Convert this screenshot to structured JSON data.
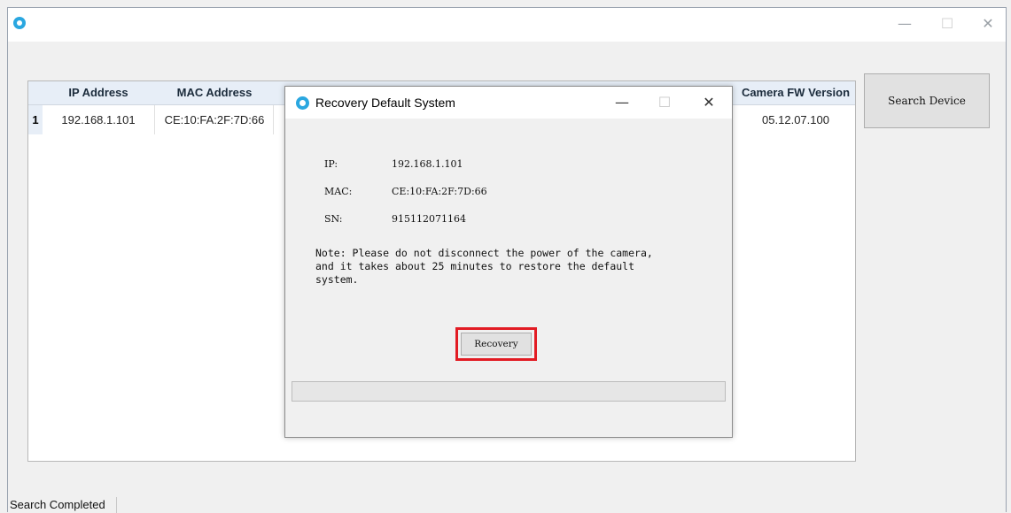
{
  "main_window": {
    "title_icon": "camera-app-icon",
    "controls": {
      "minimize": "—",
      "maximize": "☐",
      "close": "✕"
    }
  },
  "device_table": {
    "columns": [
      "IP Address",
      "MAC Address",
      "",
      "",
      "",
      "",
      "Camera FW Version"
    ],
    "rows": [
      {
        "index": "1",
        "ip": "192.168.1.101",
        "mac": "CE:10:FA:2F:7D:66",
        "fw": "05.12.07.100"
      }
    ]
  },
  "search_button_label": "Search Device",
  "status_text": "Search Completed",
  "dialog": {
    "title": "Recovery Default System",
    "controls": {
      "minimize": "—",
      "maximize": "☐",
      "close": "✕"
    },
    "ip_label": "IP:",
    "ip_value": "192.168.1.101",
    "mac_label": "MAC:",
    "mac_value": "CE:10:FA:2F:7D:66",
    "sn_label": "SN:",
    "sn_value": "915112071164",
    "note": "Note: Please do not disconnect the power of the camera,\nand it takes about 25 minutes to restore the default\nsystem.",
    "recovery_button_label": "Recovery",
    "progress_value": 0
  },
  "colors": {
    "highlight": "#e21b23",
    "accent": "#2aa7e0"
  }
}
